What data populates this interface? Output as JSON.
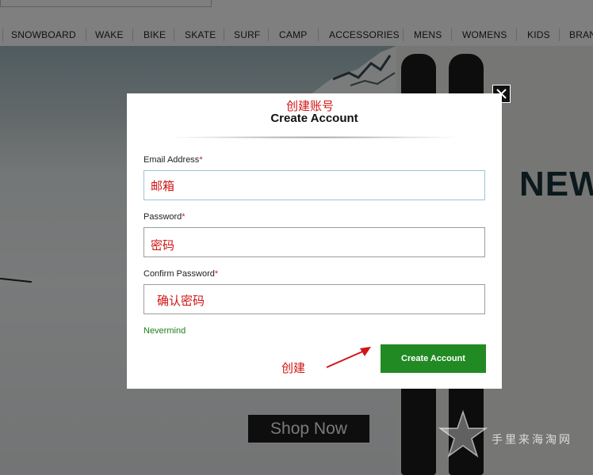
{
  "nav": {
    "items": [
      "SNOWBOARD",
      "WAKE",
      "BIKE",
      "SKATE",
      "SURF",
      "CAMP",
      "ACCESSORIES",
      "MENS",
      "WOMENS",
      "KIDS",
      "BRAN"
    ]
  },
  "hero": {
    "headline": "NEW",
    "shop_now_label": "Shop Now"
  },
  "modal": {
    "annotation_title": "创建账号",
    "title": "Create Account",
    "email_label": "Email Address",
    "email_annotation": "邮箱",
    "password_label": "Password",
    "password_annotation": "密码",
    "confirm_label": "Confirm Password",
    "confirm_annotation": "确认密码",
    "required_mark": "*",
    "nevermind_label": "Nevermind",
    "create_annotation": "创建",
    "create_button_label": "Create Account",
    "close_icon": "close-icon"
  },
  "watermark": {
    "text": "手里来海淘网"
  },
  "colors": {
    "accent_green": "#218a23",
    "annotation_red": "#d11414",
    "required_red": "#c0262d",
    "nevermind_green": "#1e7d1e"
  }
}
